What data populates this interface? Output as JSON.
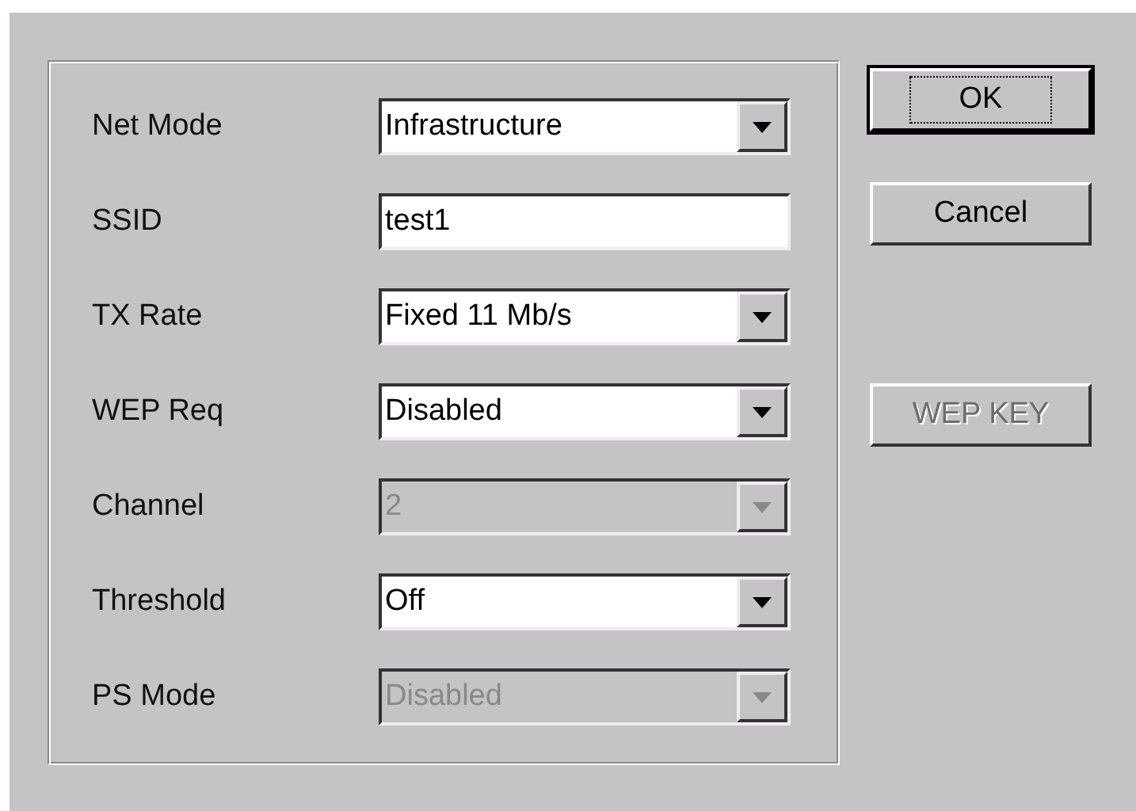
{
  "fields": [
    {
      "label": "Net Mode",
      "kind": "combo",
      "value": "Infrastructure",
      "disabled": false
    },
    {
      "label": "SSID",
      "kind": "text",
      "value": "test1",
      "disabled": false
    },
    {
      "label": "TX Rate",
      "kind": "combo",
      "value": "Fixed 11 Mb/s",
      "disabled": false
    },
    {
      "label": "WEP Req",
      "kind": "combo",
      "value": "Disabled",
      "disabled": false
    },
    {
      "label": "Channel",
      "kind": "combo",
      "value": "2",
      "disabled": true
    },
    {
      "label": "Threshold",
      "kind": "combo",
      "value": "Off",
      "disabled": false
    },
    {
      "label": "PS Mode",
      "kind": "combo",
      "value": "Disabled",
      "disabled": true
    }
  ],
  "buttons": [
    {
      "label": "OK",
      "default": true,
      "disabled": false
    },
    {
      "label": "Cancel",
      "default": false,
      "disabled": false
    },
    {
      "label": "WEP KEY",
      "default": false,
      "disabled": true
    }
  ]
}
